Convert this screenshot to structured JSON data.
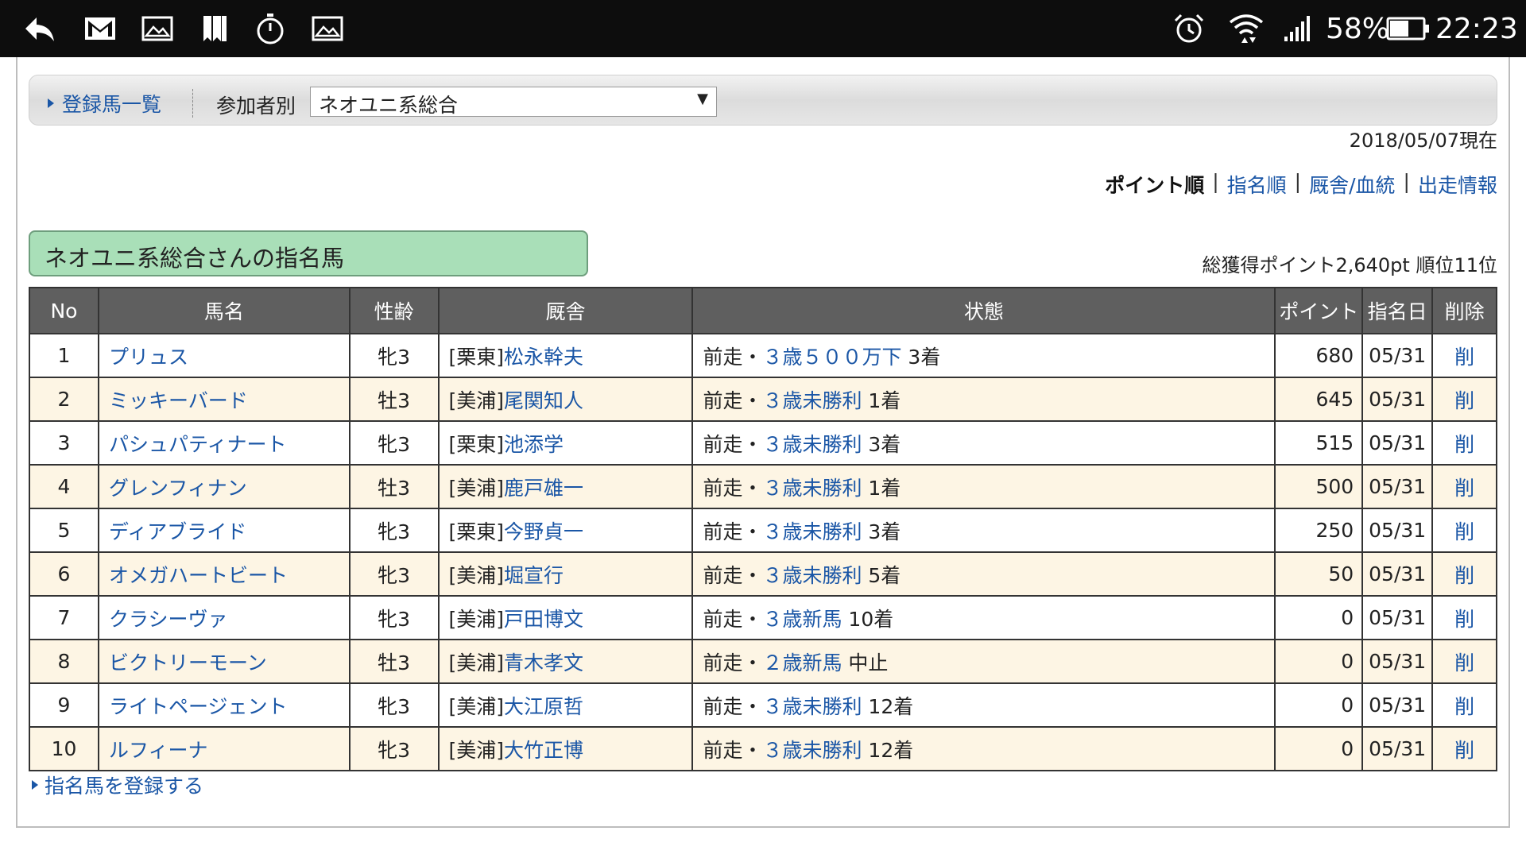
{
  "statusbar": {
    "left_icons": [
      "back-arrow-icon",
      "gmail-icon",
      "image-icon",
      "bookmarks-icon",
      "timer-icon",
      "image-icon"
    ],
    "battery": "58%",
    "time": "22:23"
  },
  "toolbar": {
    "horses_link": "登録馬一覧",
    "participant_label": "参加者別",
    "participant_selected": "ネオユニ系総合"
  },
  "date_text": "2018/05/07現在",
  "sort_nav": {
    "active": "ポイント順",
    "links": [
      "指名順",
      "厩舎/血統",
      "出走情報"
    ]
  },
  "owner_title": "ネオユニ系総合さんの指名馬",
  "totals": "総獲得ポイント2,640pt 順位11位",
  "table": {
    "headers": [
      "No",
      "馬名",
      "性齢",
      "厩舎",
      "状態",
      "ポイント",
      "指名日",
      "削除"
    ],
    "status_prefix": "前走・",
    "delete_label": "削",
    "rows": [
      {
        "no": "1",
        "name": "プリュス",
        "sexage": "牝3",
        "region": "[栗東]",
        "trainer": "松永幹夫",
        "race": "３歳５００万下",
        "result": "3着",
        "points": "680",
        "date": "05/31"
      },
      {
        "no": "2",
        "name": "ミッキーバード",
        "sexage": "牡3",
        "region": "[美浦]",
        "trainer": "尾関知人",
        "race": "３歳未勝利",
        "result": "1着",
        "points": "645",
        "date": "05/31"
      },
      {
        "no": "3",
        "name": "パシュパティナート",
        "sexage": "牝3",
        "region": "[栗東]",
        "trainer": "池添学",
        "race": "３歳未勝利",
        "result": "3着",
        "points": "515",
        "date": "05/31"
      },
      {
        "no": "4",
        "name": "グレンフィナン",
        "sexage": "牡3",
        "region": "[美浦]",
        "trainer": "鹿戸雄一",
        "race": "３歳未勝利",
        "result": "1着",
        "points": "500",
        "date": "05/31"
      },
      {
        "no": "5",
        "name": "ディアブライド",
        "sexage": "牝3",
        "region": "[栗東]",
        "trainer": "今野貞一",
        "race": "３歳未勝利",
        "result": "3着",
        "points": "250",
        "date": "05/31"
      },
      {
        "no": "6",
        "name": "オメガハートビート",
        "sexage": "牝3",
        "region": "[美浦]",
        "trainer": "堀宣行",
        "race": "３歳未勝利",
        "result": "5着",
        "points": "50",
        "date": "05/31"
      },
      {
        "no": "7",
        "name": "クラシーヴァ",
        "sexage": "牝3",
        "region": "[美浦]",
        "trainer": "戸田博文",
        "race": "３歳新馬",
        "result": "10着",
        "points": "0",
        "date": "05/31"
      },
      {
        "no": "8",
        "name": "ビクトリーモーン",
        "sexage": "牡3",
        "region": "[美浦]",
        "trainer": "青木孝文",
        "race": "２歳新馬",
        "result": "中止",
        "points": "0",
        "date": "05/31"
      },
      {
        "no": "9",
        "name": "ライトページェント",
        "sexage": "牝3",
        "region": "[美浦]",
        "trainer": "大江原哲",
        "race": "３歳未勝利",
        "result": "12着",
        "points": "0",
        "date": "05/31"
      },
      {
        "no": "10",
        "name": "ルフィーナ",
        "sexage": "牝3",
        "region": "[美浦]",
        "trainer": "大竹正博",
        "race": "３歳未勝利",
        "result": "12着",
        "points": "0",
        "date": "05/31"
      }
    ]
  },
  "register_link": "指名馬を登録する",
  "colors": {
    "link": "#1a56a6",
    "header_bg": "#5f5f5f",
    "even_row_bg": "#fdf5e4",
    "owner_box_bg": "#a9dfb8",
    "statusbar_bg": "#0d0d0d"
  }
}
